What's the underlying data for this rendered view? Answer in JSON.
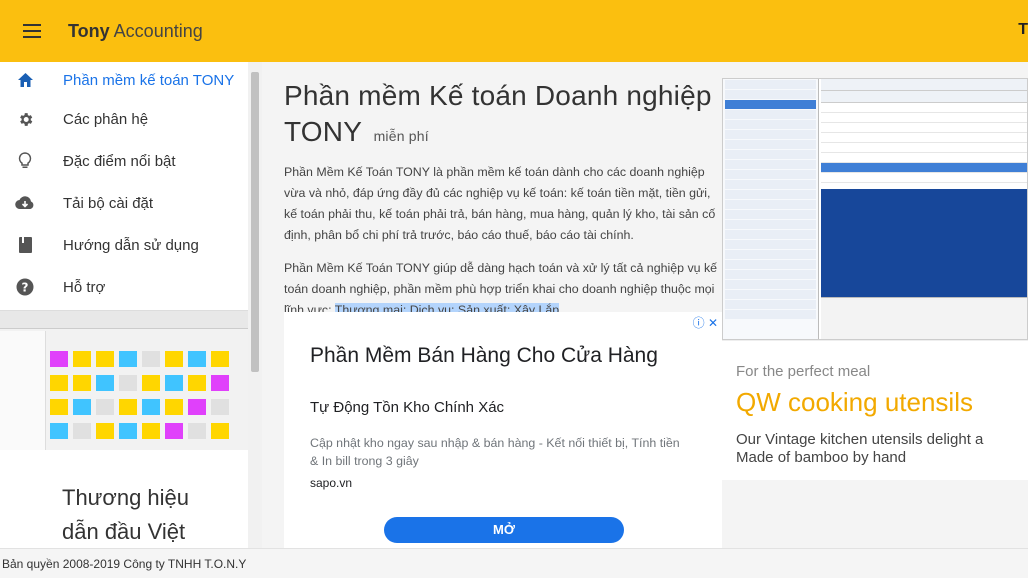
{
  "header": {
    "brand_bold": "Tony",
    "brand_rest": " Accounting",
    "right_fragment": "T"
  },
  "sidebar": {
    "items": [
      {
        "label": "Phần mềm kế toán TONY",
        "icon": "home-icon",
        "active": true
      },
      {
        "label": "Các phân hệ",
        "icon": "gear-icon"
      },
      {
        "label": "Đặc điểm nổi bật",
        "icon": "lightbulb-icon"
      },
      {
        "label": "Tải bộ cài đặt",
        "icon": "cloud-download-icon"
      },
      {
        "label": "Hướng dẫn sử dụng",
        "icon": "book-icon"
      },
      {
        "label": "Hỗ trợ",
        "icon": "help-icon"
      }
    ],
    "brand_card": {
      "line1": "Thương hiệu",
      "line2": "dẫn đầu Việt"
    }
  },
  "article": {
    "title": "Phần mềm Kế toán Doanh nghiệp",
    "title_brand": "TONY",
    "title_suffix": "miễn phí",
    "para1": "Phần Mềm Kế Toán TONY là phần mềm kế toán dành cho các doanh nghiệp vừa và nhỏ, đáp ứng đầy đủ các nghiệp vụ kế toán: kế toán tiền mặt, tiền gửi, kế toán phải thu, kế toán phải trả, bán hàng, mua hàng, quản lý kho, tài sản cố định, phân bổ chi phí trả trước, báo cáo thuế, báo cáo tài chính.",
    "para2_start": "Phần Mềm Kế Toán TONY giúp dễ dàng hạch toán và xử lý tất cả nghiệp vụ kế toán doanh nghiệp, phần mềm phù hợp triển khai cho doanh nghiệp thuộc mọi lĩnh vực: ",
    "para2_highlight": "Thương mại; Dịch vụ; Sản xuất; Xây Lắp",
    "para2_end": "."
  },
  "ad1": {
    "close": "ⓘ ✕",
    "headline": "Phần Mềm Bán Hàng Cho Cửa Hàng",
    "subhead": "Tự Động Tồn Kho Chính Xác",
    "description": "Cập nhật kho ngay sau nhập & bán hàng - Kết nối thiết bị, Tính tiền & In bill trong 3 giây",
    "domain": "sapo.vn",
    "cta": "MỞ"
  },
  "ad2": {
    "kicker": "For the perfect meal",
    "title": "QW cooking utensils",
    "desc_line1": "Our Vintage kitchen utensils delight a",
    "desc_line2": "Made of bamboo by hand"
  },
  "footer": {
    "text": "Bản quyền 2008-2019 Công ty TNHH T.O.N.Y"
  },
  "colors": {
    "accent": "#fbbf0f",
    "link": "#1a73e8",
    "ad_title": "#f2a900",
    "cta": "#1a73e8"
  }
}
